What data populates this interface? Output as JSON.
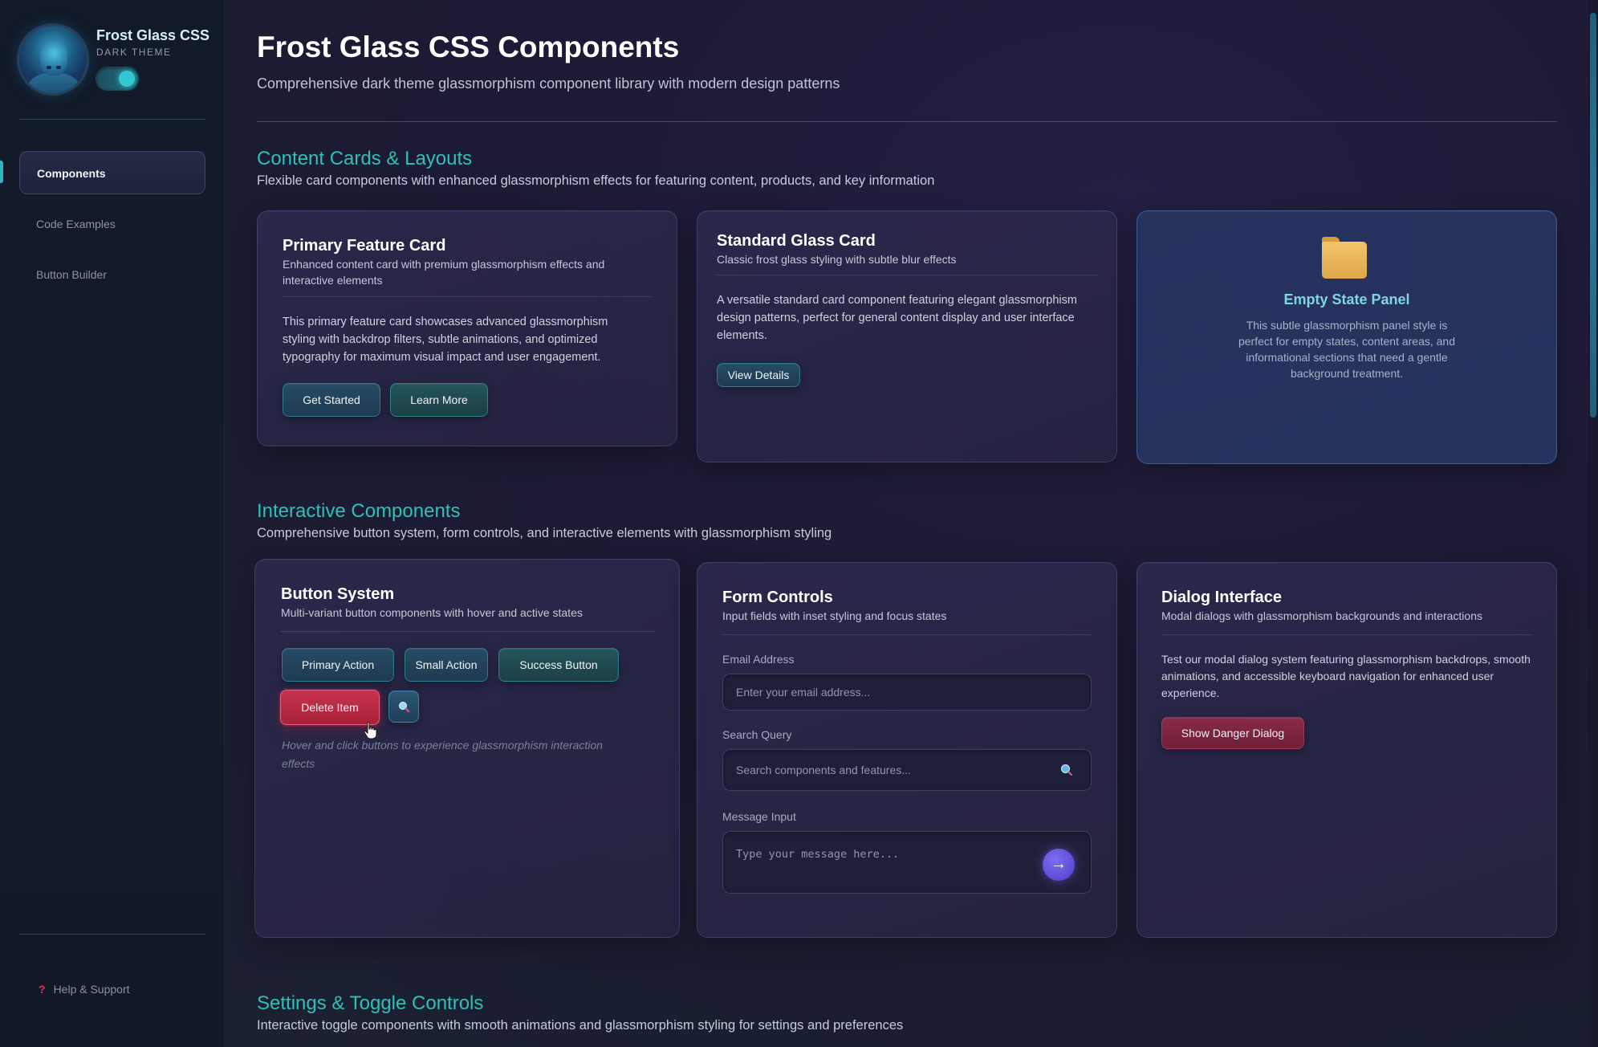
{
  "brand": {
    "title": "Frost Glass CSS",
    "subtitle": "DARK THEME",
    "theme_toggle": "on"
  },
  "sidebar": {
    "items": [
      {
        "label": "Components",
        "active": true
      },
      {
        "label": "Code Examples",
        "active": false
      },
      {
        "label": "Button Builder",
        "active": false
      }
    ],
    "help": {
      "icon": "question-icon",
      "label": "Help & Support"
    }
  },
  "header": {
    "title": "Frost Glass CSS Components",
    "subtitle": "Comprehensive dark theme glassmorphism component library with modern design patterns"
  },
  "sections": {
    "cards": {
      "title": "Content Cards & Layouts",
      "subtitle": "Flexible card components with enhanced glassmorphism effects for featuring content, products, and key information",
      "primary": {
        "title": "Primary Feature Card",
        "subtitle": "Enhanced content card with premium glassmorphism effects and interactive elements",
        "body": "This primary feature card showcases advanced glassmorphism styling with backdrop filters, subtle animations, and optimized typography for maximum visual impact and user engagement.",
        "btn_primary": "Get Started",
        "btn_secondary": "Learn More"
      },
      "standard": {
        "title": "Standard Glass Card",
        "subtitle": "Classic frost glass styling with subtle blur effects",
        "body": "A versatile standard card component featuring elegant glassmorphism design patterns, perfect for general content display and user interface elements.",
        "btn": "View Details"
      },
      "empty": {
        "icon": "folder-icon",
        "title": "Empty State Panel",
        "body": "This subtle glassmorphism panel style is perfect for empty states, content areas, and informational sections that need a gentle background treatment."
      }
    },
    "interactive": {
      "title": "Interactive Components",
      "subtitle": "Comprehensive button system, form controls, and interactive elements with glassmorphism styling",
      "buttons": {
        "title": "Button System",
        "subtitle": "Multi-variant button components with hover and active states",
        "primary": "Primary Action",
        "small": "Small Action",
        "success": "Success Button",
        "delete": "Delete Item",
        "icon_btn": "search-icon",
        "hint": "Hover and click buttons to experience glassmorphism interaction effects"
      },
      "forms": {
        "title": "Form Controls",
        "subtitle": "Input fields with inset styling and focus states",
        "email_label": "Email Address",
        "email_placeholder": "Enter your email address...",
        "search_label": "Search Query",
        "search_placeholder": "Search components and features...",
        "message_label": "Message Input",
        "message_placeholder": "Type your message here...",
        "send_glyph": "→"
      },
      "dialog": {
        "title": "Dialog Interface",
        "subtitle": "Modal dialogs with glassmorphism backgrounds and interactions",
        "body": "Test our modal dialog system featuring glassmorphism backdrops, smooth animations, and accessible keyboard navigation for enhanced user experience.",
        "btn": "Show Danger Dialog"
      }
    },
    "settings": {
      "title": "Settings & Toggle Controls",
      "subtitle": "Interactive toggle components with smooth animations and glassmorphism styling for settings and preferences"
    }
  },
  "colors": {
    "accent": "#2fc0b6",
    "danger": "#c8334d",
    "send": "#5a4ee0"
  }
}
